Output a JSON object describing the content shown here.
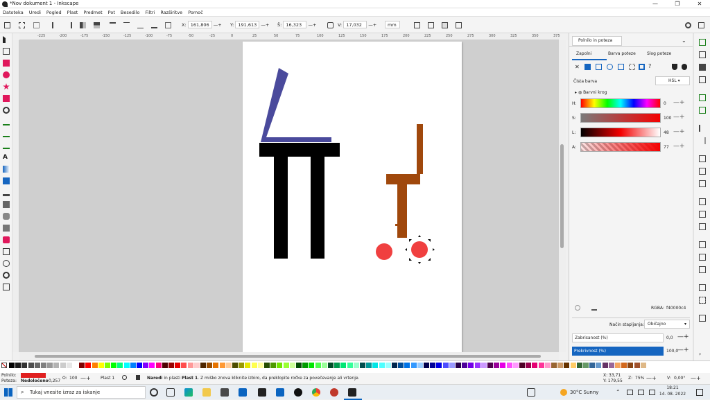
{
  "window": {
    "title": "*Nov dokument 1 - Inkscape",
    "minimize": "—",
    "maximize": "❐",
    "close": "✕"
  },
  "menu": [
    "Datoteka",
    "Uredi",
    "Pogled",
    "Plast",
    "Predmet",
    "Pot",
    "Besedilo",
    "Filtri",
    "Razširitve",
    "Pomoč"
  ],
  "toolctrl": {
    "x_label": "X:",
    "x_value": "161,806",
    "y_label": "Y:",
    "y_value": "191,613",
    "w_label": "Š:",
    "w_value": "16,323",
    "h_label": "V:",
    "h_value": "17,032",
    "unit": "mm"
  },
  "ruler_ticks": [
    "-225",
    "-200",
    "-175",
    "-150",
    "-125",
    "-100",
    "-75",
    "-50",
    "-25",
    "0",
    "25",
    "50",
    "75",
    "100",
    "125",
    "150",
    "175",
    "200",
    "225",
    "250",
    "275",
    "300",
    "325",
    "350",
    "375",
    "400",
    "425"
  ],
  "panel": {
    "tab_title": "Polnilo in poteza",
    "subtabs": [
      "Zapolni",
      "Barva poteze",
      "Slog poteze"
    ],
    "flat_color": "Čista barva",
    "mode": "HSL",
    "wheel": "Barvni krog",
    "sliders": [
      {
        "label": "H:",
        "value": "0"
      },
      {
        "label": "S:",
        "value": "100"
      },
      {
        "label": "L:",
        "value": "48"
      },
      {
        "label": "A:",
        "value": "77"
      }
    ],
    "rgba_label": "RGBA:",
    "rgba_value": "f40000c4",
    "blend_label": "Način stapljanja:",
    "blend_value": "Običajno",
    "blur_label": "Zabrisanost (%)",
    "blur_value": "0,0",
    "opacity_label": "Prekrivnost (%)",
    "opacity_value": "100,0"
  },
  "status": {
    "fill_label": "Polnilo:",
    "stroke_label": "Poteza:",
    "stroke_value": "Nedoločeno",
    "stroke_width": "0,257",
    "o_label": "O:",
    "o_value": "100",
    "layer": "Plast 1",
    "message_bold": "Naredi",
    "message_mid": " in plasti ",
    "message_layer": "Plast 1",
    "message_rest": ". Z miško znova kliknite izbiro, da preklopite ročke za povečevanje ali vrtenje.",
    "x": "X: 33,71",
    "y": "Y: 179,55",
    "z": "Z:",
    "zoom": "75%",
    "rot_label": "V:",
    "rotation": "0,00°"
  },
  "taskbar": {
    "search_placeholder": "Tukaj vnesite izraz za iskanje",
    "weather": "30°C  Sunny",
    "time": "18:21",
    "date": "14. 08. 2022"
  },
  "colors": {
    "accent_blue": "#1565c0",
    "slate_blue": "#4a4a9c",
    "brown": "#a0480c",
    "red_circle": "#f04040",
    "fill_red": "#e02020"
  }
}
